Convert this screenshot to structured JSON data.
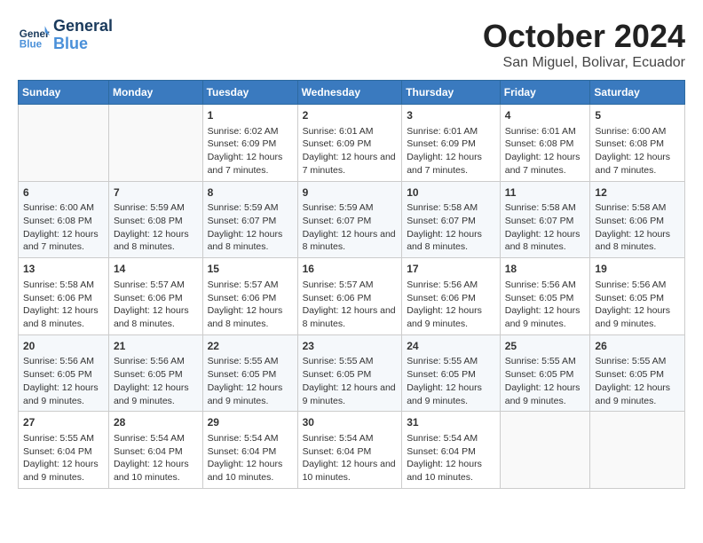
{
  "header": {
    "logo_line1": "General",
    "logo_line2": "Blue",
    "month": "October 2024",
    "location": "San Miguel, Bolivar, Ecuador"
  },
  "days_of_week": [
    "Sunday",
    "Monday",
    "Tuesday",
    "Wednesday",
    "Thursday",
    "Friday",
    "Saturday"
  ],
  "weeks": [
    [
      {
        "day": "",
        "content": ""
      },
      {
        "day": "",
        "content": ""
      },
      {
        "day": "1",
        "content": "Sunrise: 6:02 AM\nSunset: 6:09 PM\nDaylight: 12 hours and 7 minutes."
      },
      {
        "day": "2",
        "content": "Sunrise: 6:01 AM\nSunset: 6:09 PM\nDaylight: 12 hours and 7 minutes."
      },
      {
        "day": "3",
        "content": "Sunrise: 6:01 AM\nSunset: 6:09 PM\nDaylight: 12 hours and 7 minutes."
      },
      {
        "day": "4",
        "content": "Sunrise: 6:01 AM\nSunset: 6:08 PM\nDaylight: 12 hours and 7 minutes."
      },
      {
        "day": "5",
        "content": "Sunrise: 6:00 AM\nSunset: 6:08 PM\nDaylight: 12 hours and 7 minutes."
      }
    ],
    [
      {
        "day": "6",
        "content": "Sunrise: 6:00 AM\nSunset: 6:08 PM\nDaylight: 12 hours and 7 minutes."
      },
      {
        "day": "7",
        "content": "Sunrise: 5:59 AM\nSunset: 6:08 PM\nDaylight: 12 hours and 8 minutes."
      },
      {
        "day": "8",
        "content": "Sunrise: 5:59 AM\nSunset: 6:07 PM\nDaylight: 12 hours and 8 minutes."
      },
      {
        "day": "9",
        "content": "Sunrise: 5:59 AM\nSunset: 6:07 PM\nDaylight: 12 hours and 8 minutes."
      },
      {
        "day": "10",
        "content": "Sunrise: 5:58 AM\nSunset: 6:07 PM\nDaylight: 12 hours and 8 minutes."
      },
      {
        "day": "11",
        "content": "Sunrise: 5:58 AM\nSunset: 6:07 PM\nDaylight: 12 hours and 8 minutes."
      },
      {
        "day": "12",
        "content": "Sunrise: 5:58 AM\nSunset: 6:06 PM\nDaylight: 12 hours and 8 minutes."
      }
    ],
    [
      {
        "day": "13",
        "content": "Sunrise: 5:58 AM\nSunset: 6:06 PM\nDaylight: 12 hours and 8 minutes."
      },
      {
        "day": "14",
        "content": "Sunrise: 5:57 AM\nSunset: 6:06 PM\nDaylight: 12 hours and 8 minutes."
      },
      {
        "day": "15",
        "content": "Sunrise: 5:57 AM\nSunset: 6:06 PM\nDaylight: 12 hours and 8 minutes."
      },
      {
        "day": "16",
        "content": "Sunrise: 5:57 AM\nSunset: 6:06 PM\nDaylight: 12 hours and 8 minutes."
      },
      {
        "day": "17",
        "content": "Sunrise: 5:56 AM\nSunset: 6:06 PM\nDaylight: 12 hours and 9 minutes."
      },
      {
        "day": "18",
        "content": "Sunrise: 5:56 AM\nSunset: 6:05 PM\nDaylight: 12 hours and 9 minutes."
      },
      {
        "day": "19",
        "content": "Sunrise: 5:56 AM\nSunset: 6:05 PM\nDaylight: 12 hours and 9 minutes."
      }
    ],
    [
      {
        "day": "20",
        "content": "Sunrise: 5:56 AM\nSunset: 6:05 PM\nDaylight: 12 hours and 9 minutes."
      },
      {
        "day": "21",
        "content": "Sunrise: 5:56 AM\nSunset: 6:05 PM\nDaylight: 12 hours and 9 minutes."
      },
      {
        "day": "22",
        "content": "Sunrise: 5:55 AM\nSunset: 6:05 PM\nDaylight: 12 hours and 9 minutes."
      },
      {
        "day": "23",
        "content": "Sunrise: 5:55 AM\nSunset: 6:05 PM\nDaylight: 12 hours and 9 minutes."
      },
      {
        "day": "24",
        "content": "Sunrise: 5:55 AM\nSunset: 6:05 PM\nDaylight: 12 hours and 9 minutes."
      },
      {
        "day": "25",
        "content": "Sunrise: 5:55 AM\nSunset: 6:05 PM\nDaylight: 12 hours and 9 minutes."
      },
      {
        "day": "26",
        "content": "Sunrise: 5:55 AM\nSunset: 6:05 PM\nDaylight: 12 hours and 9 minutes."
      }
    ],
    [
      {
        "day": "27",
        "content": "Sunrise: 5:55 AM\nSunset: 6:04 PM\nDaylight: 12 hours and 9 minutes."
      },
      {
        "day": "28",
        "content": "Sunrise: 5:54 AM\nSunset: 6:04 PM\nDaylight: 12 hours and 10 minutes."
      },
      {
        "day": "29",
        "content": "Sunrise: 5:54 AM\nSunset: 6:04 PM\nDaylight: 12 hours and 10 minutes."
      },
      {
        "day": "30",
        "content": "Sunrise: 5:54 AM\nSunset: 6:04 PM\nDaylight: 12 hours and 10 minutes."
      },
      {
        "day": "31",
        "content": "Sunrise: 5:54 AM\nSunset: 6:04 PM\nDaylight: 12 hours and 10 minutes."
      },
      {
        "day": "",
        "content": ""
      },
      {
        "day": "",
        "content": ""
      }
    ]
  ]
}
